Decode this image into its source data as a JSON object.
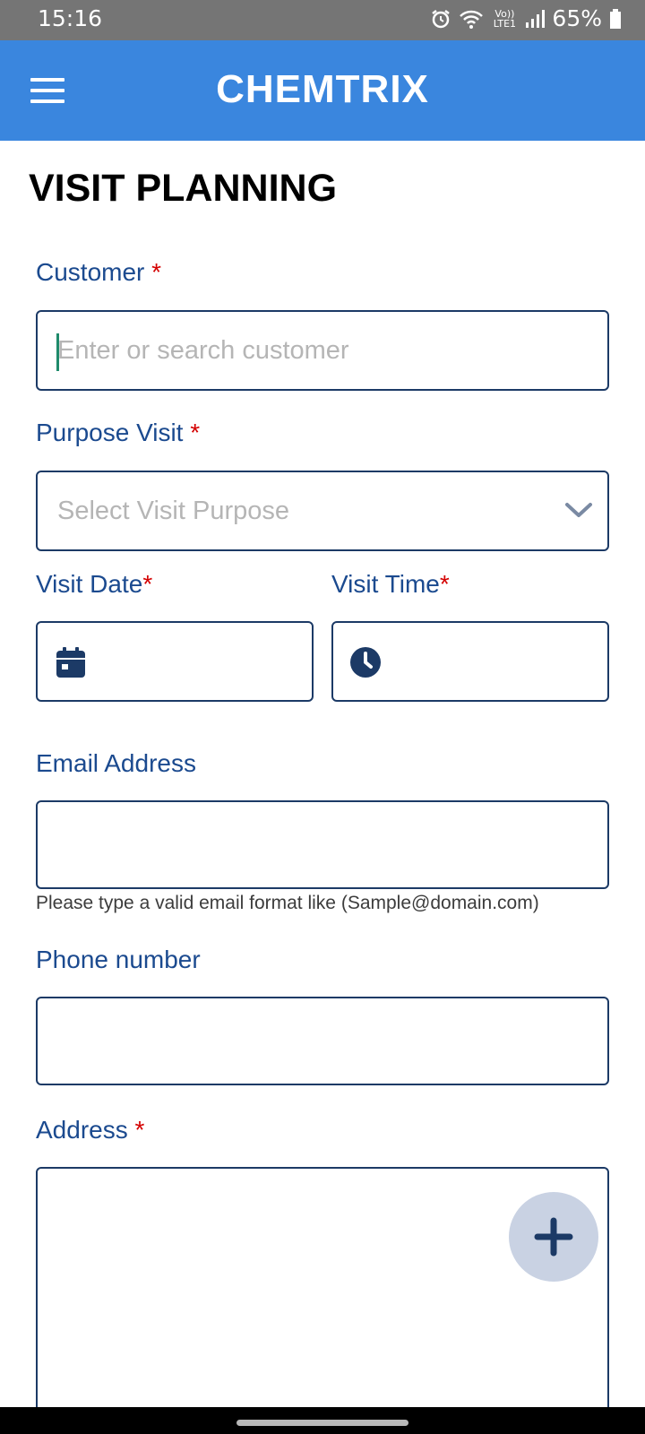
{
  "status_bar": {
    "time": "15:16",
    "battery": "65%",
    "icons": [
      "alarm-icon",
      "wifi-icon",
      "volte-icon",
      "signal-icon",
      "battery-icon"
    ],
    "volte_text": "Vo)) LTE1"
  },
  "app_bar": {
    "title": "CHEMTRIX",
    "color": "#3a86de",
    "menu_icon": "hamburger-menu-icon"
  },
  "page": {
    "title": "VISIT PLANNING"
  },
  "form": {
    "customer": {
      "label": "Customer",
      "required_mark": "*",
      "placeholder": "Enter or search customer",
      "value": ""
    },
    "purpose": {
      "label": "Purpose Visit",
      "required_mark": "*",
      "placeholder": "Select Visit Purpose",
      "icon": "chevron-down-icon"
    },
    "visit_date": {
      "label": "Visit Date",
      "required_mark": "*",
      "icon": "calendar-icon",
      "value": ""
    },
    "visit_time": {
      "label": "Visit Time",
      "required_mark": "*",
      "icon": "clock-icon",
      "value": ""
    },
    "email": {
      "label": "Email Address",
      "value": "",
      "hint": "Please type a valid email format like (Sample@domain.com)"
    },
    "phone": {
      "label": "Phone number",
      "value": ""
    },
    "address": {
      "label": "Address",
      "required_mark": "*",
      "value": "",
      "add_icon": "plus-icon"
    }
  },
  "colors": {
    "label": "#1b4a8f",
    "required": "#d40000",
    "border": "#1c3a66",
    "fab": "#c9d2e3"
  }
}
